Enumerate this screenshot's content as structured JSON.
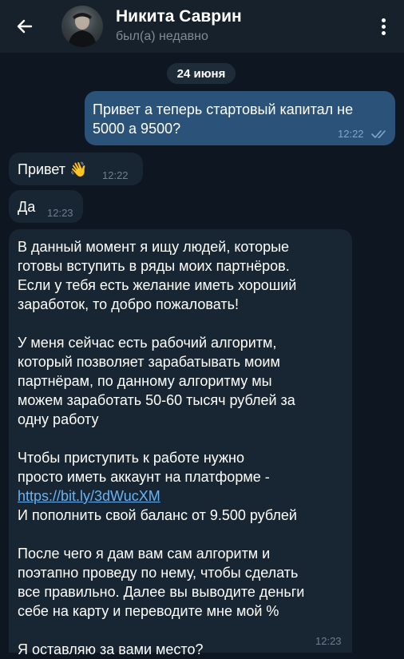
{
  "header": {
    "back_icon": "arrow-left-icon",
    "contact_name": "Никита Саврин",
    "status": "был(а) недавно",
    "menu_icon": "kebab-menu-icon"
  },
  "date_divider": "24 июня",
  "messages": [
    {
      "direction": "outgoing",
      "lines": [
        "Привет а теперь стартовый капитал не",
        "5000 а 9500?"
      ],
      "time": "12:22",
      "read_icon": "double-check-icon"
    },
    {
      "direction": "incoming",
      "text": "Привет",
      "emoji": "👋",
      "time": "12:22"
    },
    {
      "direction": "incoming",
      "text": "Да",
      "time": "12:23"
    },
    {
      "direction": "incoming",
      "paragraph1": [
        "В данный момент я ищу людей, которые",
        "готовы вступить в ряды моих партнёров.",
        "Если у тебя есть желание иметь хороший",
        "заработок, то добро пожаловать!"
      ],
      "paragraph2": [
        "У меня сейчас есть рабочий алгоритм,",
        "который позволяет зарабатывать моим",
        "партнёрам, по данному алгоритму мы",
        "можем заработать 50-60 тысяч рублей за",
        "одну работу"
      ],
      "paragraph3_before": [
        "Чтобы приступить к работе нужно",
        "просто иметь аккаунт на платформе -"
      ],
      "link": "https://bit.ly/3dWucXM",
      "paragraph3_after": "И пополнить свой баланс от 9.500 рублей",
      "paragraph4": [
        "После чего я дам вам сам алгоритм и",
        "поэтапно проведу по нему, чтобы сделать",
        "все правильно. Далее вы выводите деньги",
        "себе на карту и переводите мне мой %"
      ],
      "paragraph5": "Я оставляю за вами место?",
      "time": "12:23"
    }
  ],
  "colors": {
    "background": "#0e1621",
    "header": "#17212b",
    "outgoing_bubble": "#2b5278",
    "incoming_bubble": "#182533",
    "link": "#6ab3f3",
    "date_pill": "#1e2c3a"
  }
}
